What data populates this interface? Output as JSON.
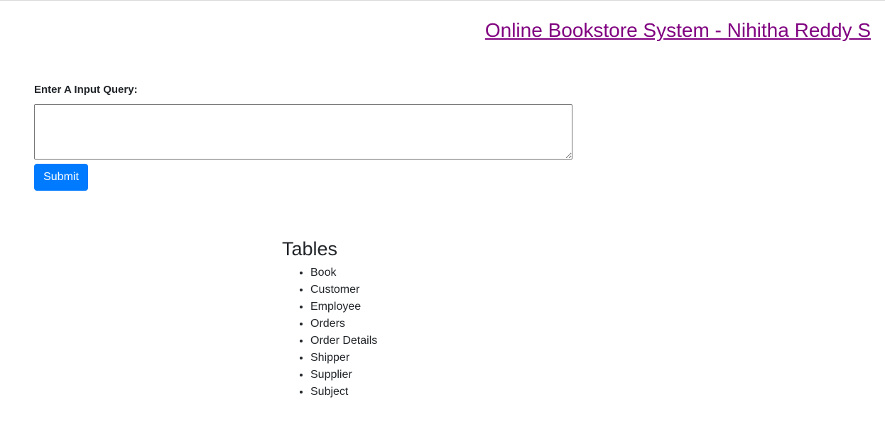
{
  "header": {
    "title": "Online Bookstore System - Nihitha Reddy S"
  },
  "query_form": {
    "label": "Enter A Input Query:",
    "input_value": "",
    "submit_label": "Submit"
  },
  "tables": {
    "heading": "Tables",
    "items": [
      "Book",
      "Customer",
      "Employee",
      "Orders",
      "Order Details",
      "Shipper",
      "Supplier",
      "Subject"
    ]
  },
  "colors": {
    "link_visited": "#800080",
    "primary_button": "#007bff",
    "text": "#212529"
  }
}
